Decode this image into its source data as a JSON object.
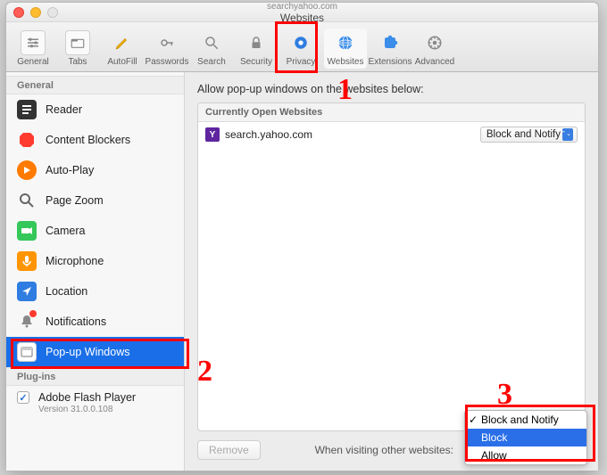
{
  "window": {
    "url_hint": "searchyahoo.com",
    "subtitle": "Websites"
  },
  "toolbar": {
    "items": [
      {
        "id": "general",
        "label": "General"
      },
      {
        "id": "tabs",
        "label": "Tabs"
      },
      {
        "id": "autofill",
        "label": "AutoFill"
      },
      {
        "id": "passwords",
        "label": "Passwords"
      },
      {
        "id": "search",
        "label": "Search"
      },
      {
        "id": "security",
        "label": "Security"
      },
      {
        "id": "privacy",
        "label": "Privacy"
      },
      {
        "id": "websites",
        "label": "Websites",
        "active": true
      },
      {
        "id": "extensions",
        "label": "Extensions"
      },
      {
        "id": "advanced",
        "label": "Advanced"
      }
    ]
  },
  "sidebar": {
    "sections": {
      "general": {
        "header": "General",
        "items": [
          {
            "id": "reader",
            "label": "Reader"
          },
          {
            "id": "content-blockers",
            "label": "Content Blockers"
          },
          {
            "id": "auto-play",
            "label": "Auto-Play"
          },
          {
            "id": "page-zoom",
            "label": "Page Zoom"
          },
          {
            "id": "camera",
            "label": "Camera"
          },
          {
            "id": "microphone",
            "label": "Microphone"
          },
          {
            "id": "location",
            "label": "Location"
          },
          {
            "id": "notifications",
            "label": "Notifications",
            "badge": true
          },
          {
            "id": "popup-windows",
            "label": "Pop-up Windows",
            "selected": true
          }
        ]
      },
      "plugins": {
        "header": "Plug-ins",
        "items": [
          {
            "id": "flash",
            "label": "Adobe Flash Player",
            "sub": "Version 31.0.0.108",
            "checked": true
          }
        ]
      }
    }
  },
  "main": {
    "heading": "Allow pop-up windows on the websites below:",
    "table_header": "Currently Open Websites",
    "rows": [
      {
        "favicon_letter": "Y",
        "site": "search.yahoo.com",
        "policy": "Block and Notify"
      }
    ],
    "remove_label": "Remove",
    "footer_label": "When visiting other websites:",
    "dropdown_options": [
      {
        "label": "Block and Notify",
        "checked": true
      },
      {
        "label": "Block",
        "selected": true
      },
      {
        "label": "Allow"
      }
    ]
  },
  "annotations": {
    "one": "1",
    "two": "2",
    "three": "3"
  },
  "colors": {
    "accent": "#1a6fe8",
    "red": "#ff0000"
  }
}
